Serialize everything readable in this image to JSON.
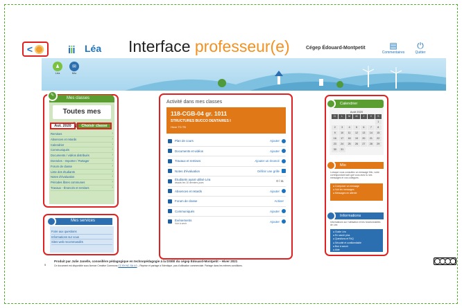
{
  "header": {
    "back_label": "<",
    "app_name": "Léa",
    "title_start": "Interface ",
    "title_accent": "professeur(e)",
    "school": "Cégep Édouard-Montpetit",
    "comments_label": "Commentaires",
    "quit_label": "Quitter"
  },
  "banner": {
    "icons": [
      {
        "label": "Léa",
        "icon": "family-icon",
        "color": "#7cc242"
      },
      {
        "label": "Mio",
        "icon": "mail-icon",
        "color": "#2b6fb0"
      }
    ]
  },
  "my_classes": {
    "header": "Mes classes",
    "all_classes": "Toutes mes classes",
    "session": "Aut. 2020",
    "choose_class": "Choisir classe",
    "items": [
      "Remises",
      "Absences et retards",
      "Calendrier",
      "Communiqués",
      "Documents / vidéos distribués",
      "Données - Importer / Partager",
      "Forum de classe",
      "Liste des étudiants",
      "Notes d'évaluation",
      "Périodes libres communes",
      "Travaux - Énoncés et remises"
    ]
  },
  "services": {
    "header": "Mes services",
    "items": [
      "Foire aux questions",
      "Informations sur vous",
      "Sites web recommandés"
    ]
  },
  "activity": {
    "heading": "Activité dans mes classes",
    "course_code": "118-CGB-04 gr. 1011",
    "course_name": "STRUCTURES BUCCO DENTAIRES I",
    "course_sub": "Hiver TD TB",
    "rows": [
      {
        "label": "Plan de cours",
        "sub": "",
        "action": "Ajouter",
        "icon": "plan-icon"
      },
      {
        "label": "Documents et vidéos",
        "sub": "",
        "action": "Ajouter",
        "icon": "documents-icon"
      },
      {
        "label": "Travaux et remises",
        "sub": "",
        "action": "Ajouter un énoncé",
        "icon": "assignment-icon"
      },
      {
        "label": "Notes d'évaluation",
        "sub": "",
        "action": "Définir une grille",
        "icon": "grades-icon"
      },
      {
        "label": "Étudiants ayant utilisé Léa",
        "sub": "depuis les 10 derniers jours",
        "action": "0 / 11",
        "icon": "students-icon"
      },
      {
        "label": "Absences et retards",
        "sub": "",
        "action": "Ajouter",
        "icon": "absence-icon"
      },
      {
        "label": "Forum de classe",
        "sub": "",
        "action": "Activer",
        "icon": "forum-icon"
      },
      {
        "label": "Communiqués",
        "sub": "",
        "action": "Ajouter",
        "icon": "announcement-icon"
      },
      {
        "label": "Événements",
        "sub": "Voir à venir",
        "action": "Ajouter",
        "icon": "calendar-icon"
      }
    ]
  },
  "calendar": {
    "header": "Calendrier",
    "month": "Août 2020",
    "days_header": [
      "D",
      "L",
      "M",
      "M",
      "J",
      "V",
      "S"
    ],
    "days": [
      "",
      "",
      "",
      "",
      "",
      "",
      "1",
      "2",
      "3",
      "4",
      "5",
      "6",
      "7",
      "8",
      "9",
      "10",
      "11",
      "12",
      "13",
      "14",
      "15",
      "16",
      "17",
      "18",
      "19",
      "20",
      "21",
      "22",
      "23",
      "24",
      "25",
      "26",
      "27",
      "28",
      "29",
      "30",
      "31",
      "",
      "",
      "",
      "",
      ""
    ]
  },
  "mio": {
    "header": "Mio",
    "text": "Lorsque vous consultez un message Mio, votre correspondant sait que vous avez lu ses messages et vos collègues.",
    "items": [
      "Composer un message",
      "Voir les messages",
      "Messages en attente"
    ]
  },
  "informations": {
    "header": "Informations",
    "text": "Informations sur l'utilisation et les fonctionnalités de Léa",
    "items": [
      "Guide Léa",
      "En savoir plus",
      "Questions et FAQ",
      "Sécurité et confidentialité",
      "Bon à savoir",
      "Aide"
    ]
  },
  "footer": {
    "number": "5",
    "line1": "Produit par Julie Janelle, conseillère pédagogique en technopédagogie à la DSÉÉ du cégep Édouard-Montpetit – Hiver 2021",
    "line2_start": "Ce document est disponible sous licence Creative Commons ",
    "license_link": "CC BY-NC-SA 4.0",
    "line2_end": " – Reprise et partage à l'identique, pas d'utilisation commerciale. Partage dans les mêmes conditions.",
    "cc_label": "CC BY NC SA"
  },
  "colors": {
    "green": "#5a9e32",
    "blue": "#2b6fb0",
    "orange": "#e07818",
    "highlight": "#e02020"
  }
}
